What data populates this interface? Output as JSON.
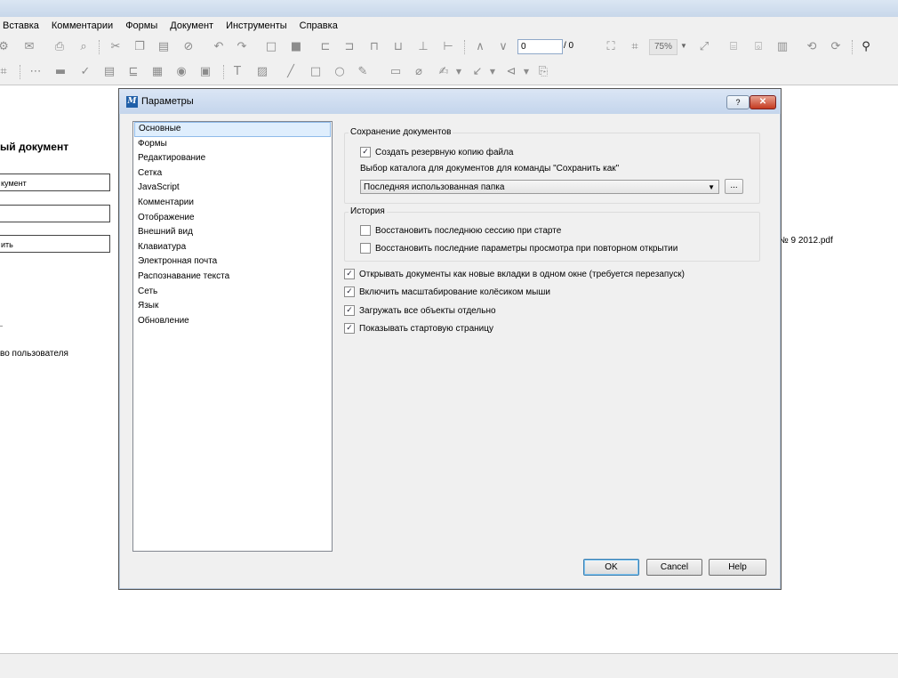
{
  "menu": [
    "Вставка",
    "Комментарии",
    "Формы",
    "Документ",
    "Инструменты",
    "Справка"
  ],
  "toolbar": {
    "page_value": "0",
    "page_total": "/ 0",
    "zoom": "75%"
  },
  "background": {
    "doc_title": "ый документ",
    "btn1": "кумент",
    "btn2": "",
    "btn3": "ить",
    "guide": "во пользователя",
    "recent_file": "№ 9 2012.pdf"
  },
  "dialog": {
    "title": "Параметры",
    "help_glyph": "?",
    "close_glyph": "✕",
    "categories": [
      "Основные",
      "Формы",
      "Редактирование",
      "Сетка",
      "JavaScript",
      "Комментарии",
      "Отображение",
      "Внешний вид",
      "Клавиатура",
      "Электронная почта",
      "Распознавание текста",
      "Сеть",
      "Язык",
      "Обновление"
    ],
    "save_group": {
      "title": "Сохранение документов",
      "backup": "Создать резервную копию файла",
      "dir_label": "Выбор каталога для документов для команды \"Сохранить как\"",
      "dir_value": "Последняя использованная папка",
      "browse": "..."
    },
    "history_group": {
      "title": "История",
      "restore_session": "Восстановить последнюю сессию при старте",
      "restore_view": "Восстановить последние параметры просмотра при повторном открытии"
    },
    "options": [
      "Открывать документы как новые вкладки в одном окне (требуется перезапуск)",
      "Включить масштабирование колёсиком мыши",
      "Загружать все объекты отдельно",
      "Показывать стартовую страницу"
    ],
    "check": "✓",
    "ok": "OK",
    "cancel": "Cancel",
    "help": "Help"
  }
}
